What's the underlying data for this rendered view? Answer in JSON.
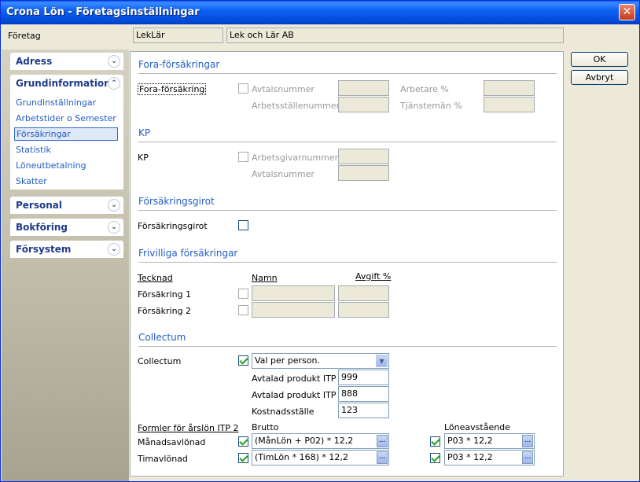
{
  "window": {
    "title": "Crona Lön - Företagsinställningar",
    "close": "✕"
  },
  "company": {
    "label": "Företag",
    "code": "LekLär",
    "name": "Lek och  Lär AB"
  },
  "buttons": {
    "ok": "OK",
    "cancel": "Avbryt"
  },
  "sidebar": {
    "adress": "Adress",
    "grund": "Grundinformation",
    "items": [
      "Grundinställningar",
      "Arbetstider o Semester",
      "Försäkringar",
      "Statistik",
      "Löneutbetalning",
      "Skatter"
    ],
    "personal": "Personal",
    "bokforing": "Bokföring",
    "forsystem": "Försystem"
  },
  "fora": {
    "title": "Fora-försäkringar",
    "checkbox_label": "Fora-försäkring",
    "avtalsnummer": "Avtalsnummer",
    "arbetsstallenummer": "Arbetsställenummer",
    "arbetare": "Arbetare %",
    "tjansteman": "Tjänstemän %"
  },
  "kp": {
    "title": "KP",
    "label": "KP",
    "arbetsgivarnummer": "Arbetsgivarnummer",
    "avtalsnummer": "Avtalsnummer"
  },
  "girot": {
    "title": "Försäkringsgirot",
    "label": "Försäkringsgirot"
  },
  "frivilliga": {
    "title": "Frivilliga försäkringar",
    "col_tecknad": "Tecknad",
    "col_namn": "Namn",
    "col_avgift": "Avgift %",
    "row1": "Försäkring 1",
    "row2": "Försäkring 2"
  },
  "collectum": {
    "title": "Collectum",
    "label": "Collectum",
    "select_value": "Val per person.",
    "itp1_label": "Avtalad produkt ITP 1",
    "itp1_value": "999",
    "itp2_label": "Avtalad produkt ITP 2",
    "itp2_value": "888",
    "kostnad_label": "Kostnadsställe",
    "kostnad_value": "123",
    "formler_label": "Formler för årslön ITP 2",
    "brutto_label": "Brutto",
    "loneavstaende_label": "Löneavstående",
    "manad_label": "Månadsavlönad",
    "manad_brutto": "(MånLön + P02) * 12,2",
    "manad_lone": "P03 * 12,2",
    "tim_label": "Timavlönad",
    "tim_brutto": "(TimLön * 168) * 12,2",
    "tim_lone": "P03 * 12,2",
    "ellipsis": "..."
  }
}
